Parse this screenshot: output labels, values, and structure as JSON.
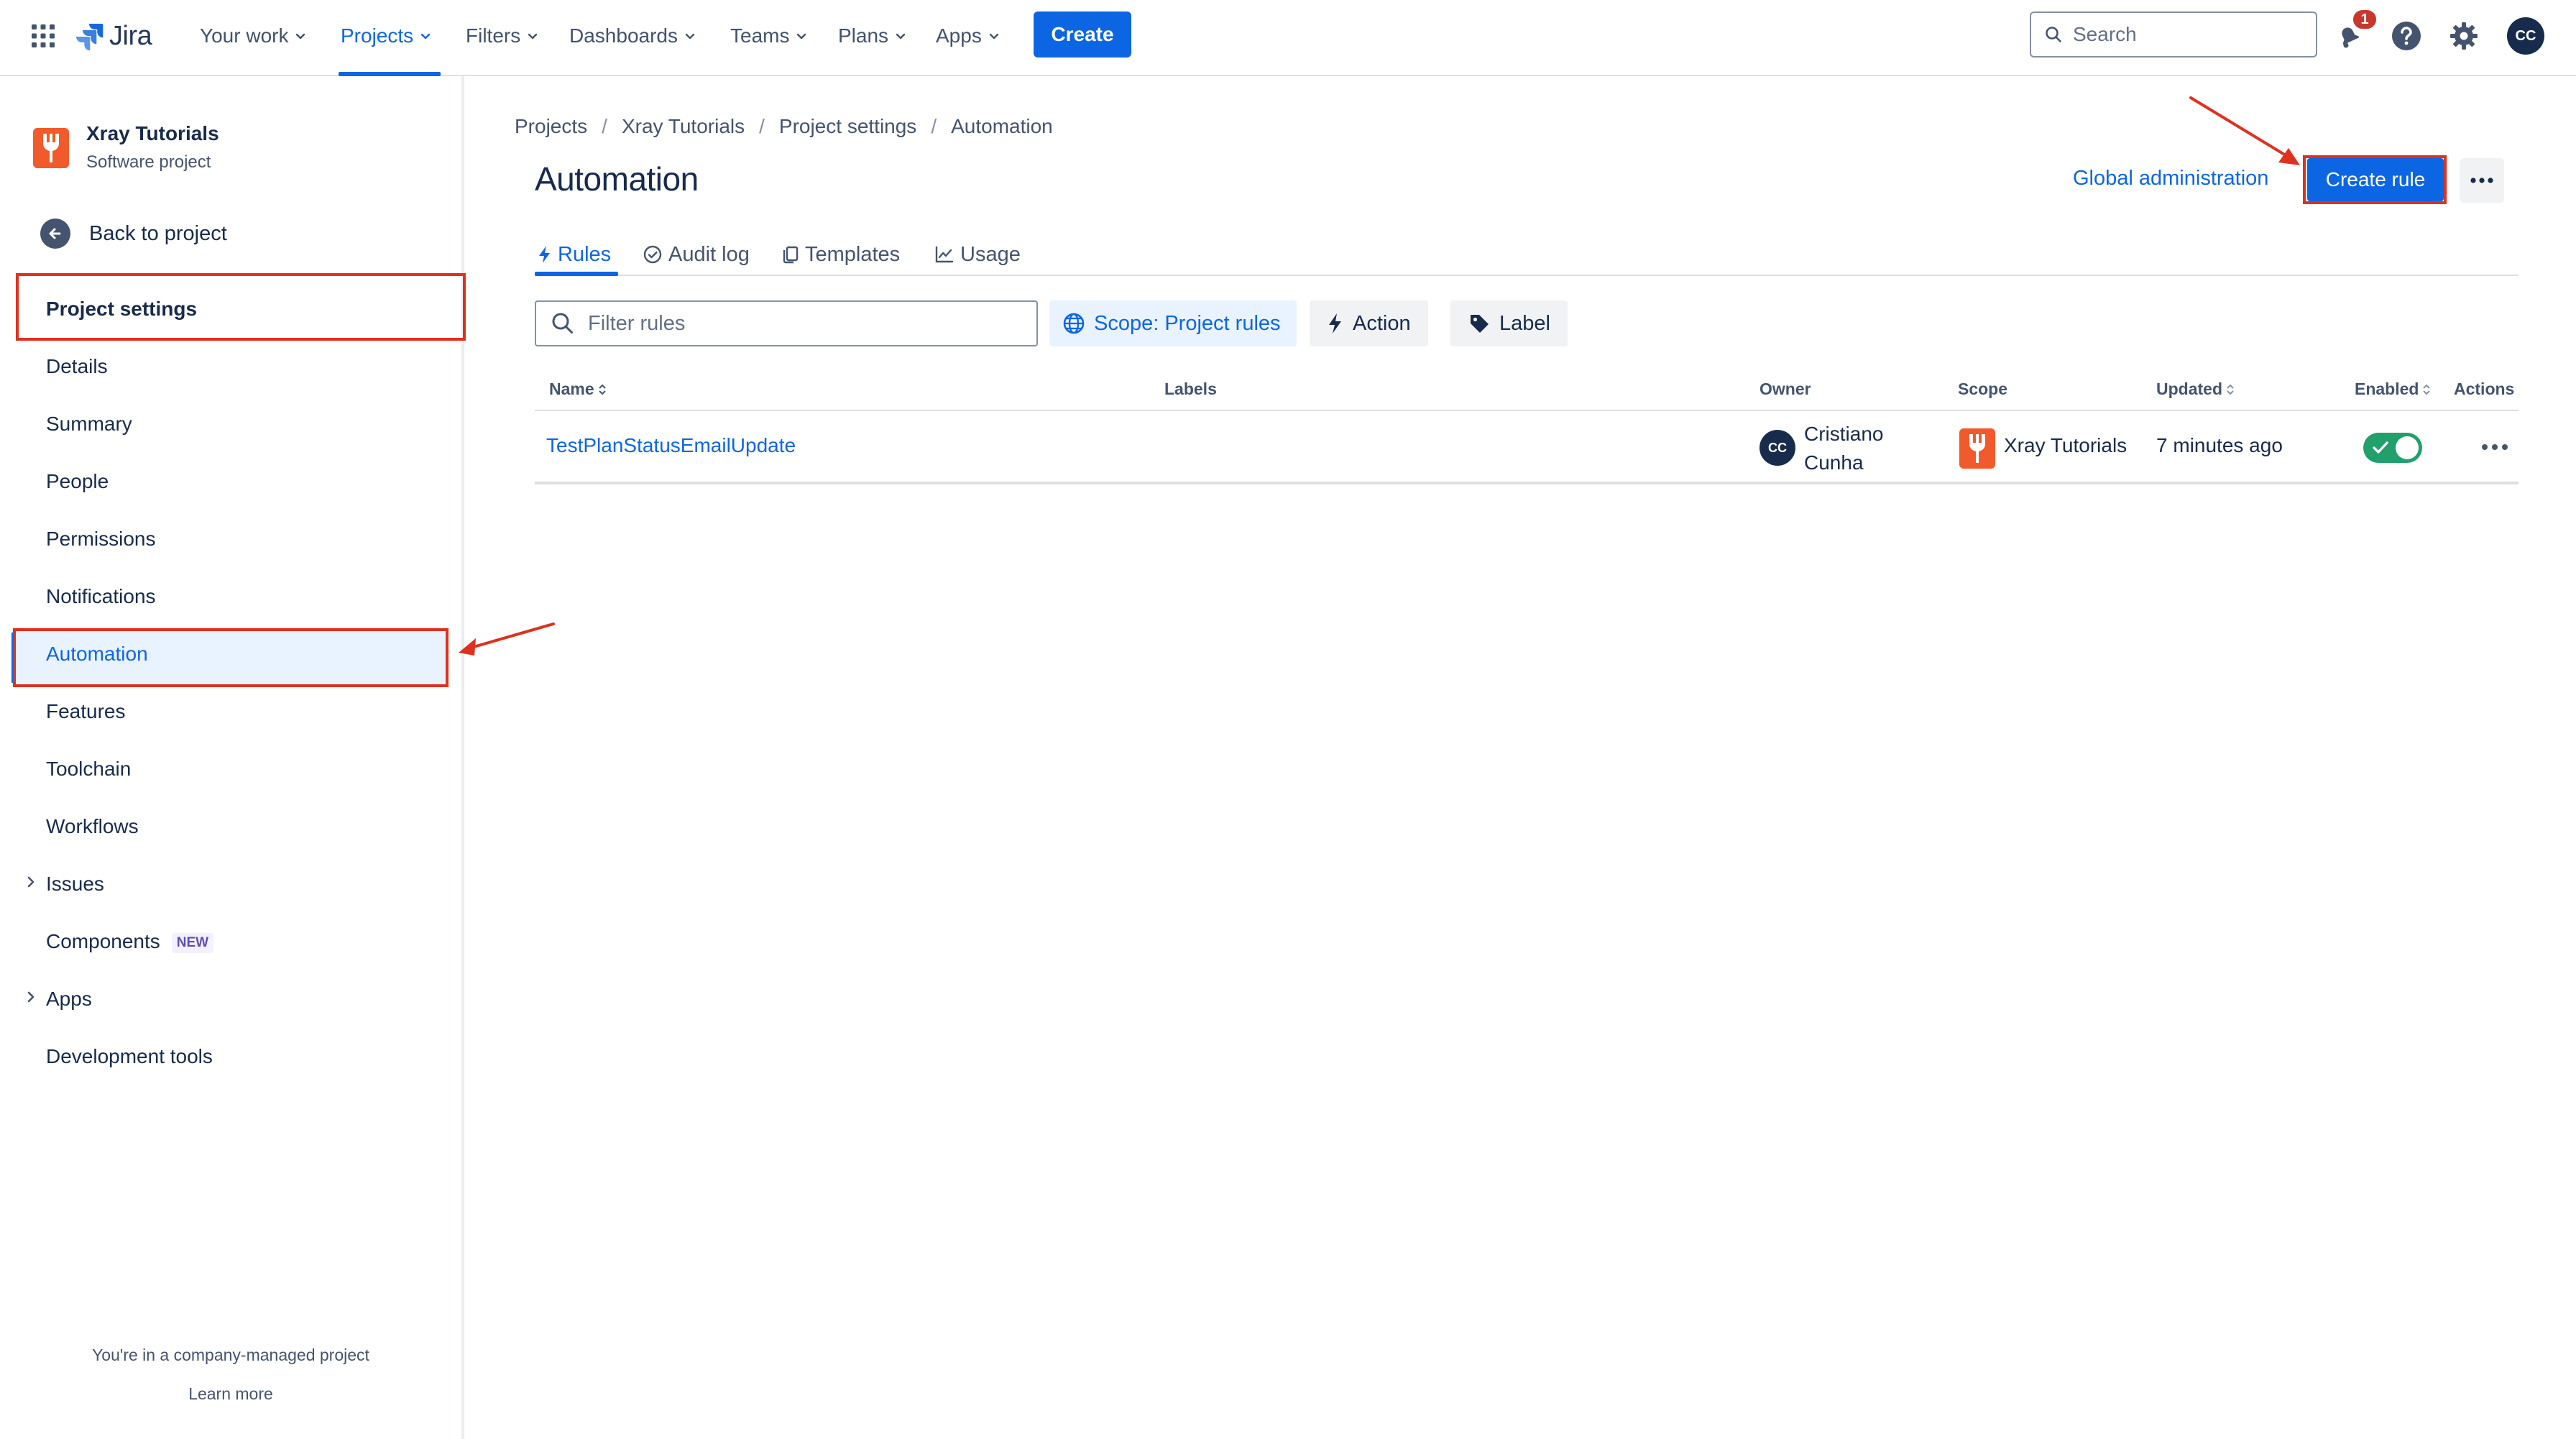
{
  "topnav": {
    "logo_text": "Jira",
    "items": [
      {
        "label": "Your work"
      },
      {
        "label": "Projects"
      },
      {
        "label": "Filters"
      },
      {
        "label": "Dashboards"
      },
      {
        "label": "Teams"
      },
      {
        "label": "Plans"
      },
      {
        "label": "Apps"
      }
    ],
    "active_item": "Projects",
    "create_label": "Create",
    "search_placeholder": "Search",
    "notification_count": "1",
    "user_initials": "CC"
  },
  "sidebar": {
    "project_name": "Xray Tutorials",
    "project_type": "Software project",
    "back_label": "Back to project",
    "section_heading": "Project settings",
    "items": [
      {
        "label": "Details"
      },
      {
        "label": "Summary"
      },
      {
        "label": "People"
      },
      {
        "label": "Permissions"
      },
      {
        "label": "Notifications"
      },
      {
        "label": "Automation"
      },
      {
        "label": "Features"
      },
      {
        "label": "Toolchain"
      },
      {
        "label": "Workflows"
      },
      {
        "label": "Issues"
      },
      {
        "label": "Components",
        "badge": "NEW"
      },
      {
        "label": "Apps"
      },
      {
        "label": "Development tools"
      }
    ],
    "active_item": "Automation",
    "footer_text": "You're in a company-managed project",
    "footer_link": "Learn more"
  },
  "main": {
    "breadcrumb": [
      "Projects",
      "Xray Tutorials",
      "Project settings",
      "Automation"
    ],
    "breadcrumb_separator": "/",
    "title": "Automation",
    "global_admin_label": "Global administration",
    "create_rule_label": "Create rule",
    "tabs": [
      {
        "label": "Rules",
        "icon": "bolt-icon"
      },
      {
        "label": "Audit log",
        "icon": "check-circle-icon"
      },
      {
        "label": "Templates",
        "icon": "copy-icon"
      },
      {
        "label": "Usage",
        "icon": "chart-icon"
      }
    ],
    "active_tab": "Rules",
    "filter_placeholder": "Filter rules",
    "chips": {
      "scope": "Scope: Project rules",
      "action": "Action",
      "label": "Label"
    },
    "table": {
      "columns": [
        "Name",
        "Labels",
        "Owner",
        "Scope",
        "Updated",
        "Enabled",
        "Actions"
      ],
      "rows": [
        {
          "name": "TestPlanStatusEmailUpdate",
          "labels": "",
          "owner_initials": "CC",
          "owner_first": "Cristiano",
          "owner_last": "Cunha",
          "scope": "Xray Tutorials",
          "updated": "7 minutes ago",
          "enabled": true
        }
      ]
    }
  },
  "colors": {
    "accent": "#0c66e4",
    "annotation_red": "#e0301e",
    "toggle_on": "#22a06b",
    "project_logo": "#f15a2b"
  }
}
